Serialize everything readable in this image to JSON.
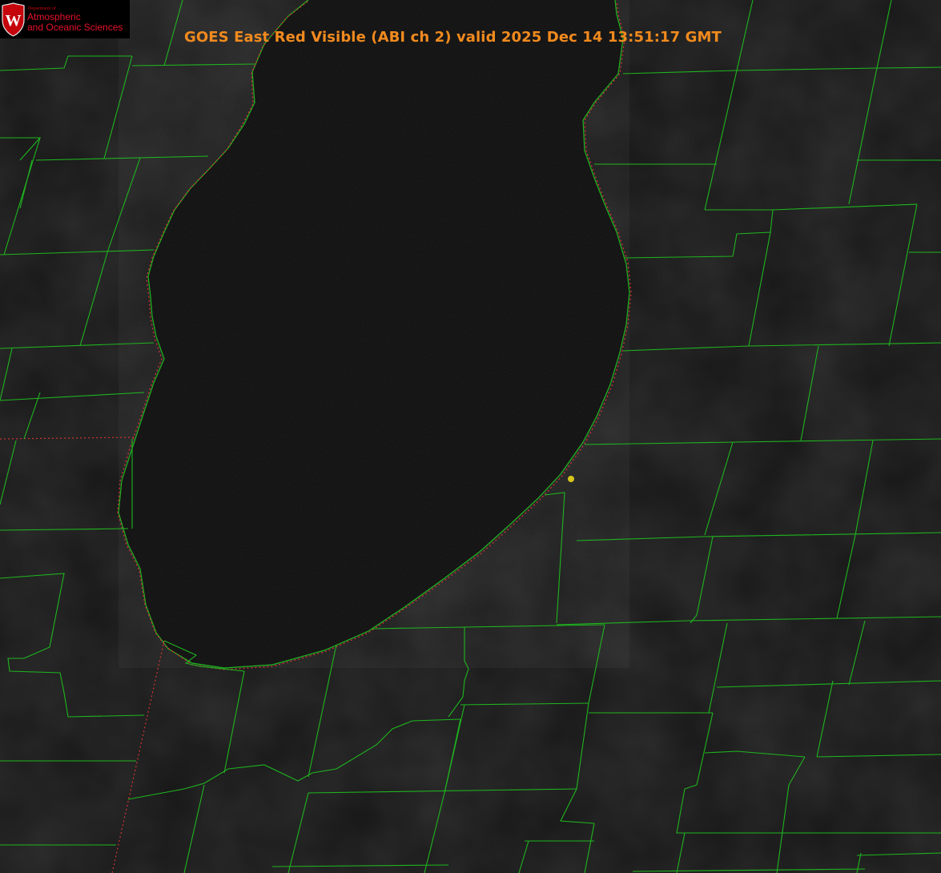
{
  "logo": {
    "department": "Department of",
    "line1": "Atmospheric",
    "line2": "and Oceanic Sciences",
    "shield_letter": "W",
    "shield_color": "#c5050c"
  },
  "title": "GOES East Red Visible (ABI ch 2) valid 2025 Dec 14 13:51:17 GMT",
  "colors": {
    "title": "#f18a1e",
    "boundaries": "#1fb51f",
    "state_line": "#d23232",
    "marker": "#d6c51a",
    "land": "#161616",
    "lake": "#0d0d0d"
  }
}
